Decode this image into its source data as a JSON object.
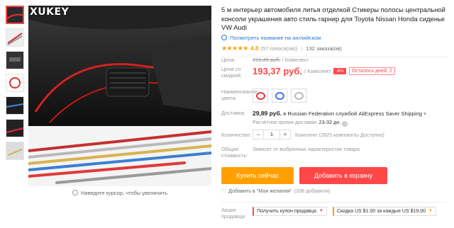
{
  "brand_logo": "XUKEY",
  "zoom_hint": "Наведите курсор, чтобы увеличить",
  "title": "5 м интерьер автомобиля литья отделкой Стикеры полосы центральной консоли украшения авто стиль гарнир для Toyota Nissan Honda сиденье VW Audi",
  "translate_link": "Посмотреть название на английском",
  "rating": {
    "stars": "★★★★★",
    "value": "4.8",
    "reviews": "(57 голоса(ов))",
    "orders": "132 заказа(ов)"
  },
  "price": {
    "label_old": "Цена:",
    "old_value": "210,45 руб.",
    "old_unit": "/ Комплект",
    "label_new": "Цена со скидкой:",
    "new_value": "193,37 руб.",
    "new_unit": "/ Комплект",
    "discount": "-8%",
    "timer": "Осталось дней: 2"
  },
  "colors": {
    "label": "Наименование цвета:",
    "swatch_colors": [
      "#e23b3b",
      "#3b7ae2",
      "#b9b9b9"
    ]
  },
  "shipping": {
    "label": "Доставка:",
    "price": "29,89 руб.",
    "text_in": "в Russian Federation службой AliExpress Saver Shipping",
    "eta_label": "Расчётное время доставки:",
    "eta_value": "23-32 дн.",
    "info_icon": "i"
  },
  "quantity": {
    "label": "Количество:",
    "minus": "−",
    "value": "1",
    "plus": "+",
    "available": "Комплект (2825 комплекты Доступно)"
  },
  "total": {
    "label": "Общая стоимость:",
    "text": "Зависит от выбранных характеристик товара"
  },
  "buttons": {
    "buy_now": "Купить сейчас",
    "add_to_cart": "Добавить в корзину"
  },
  "wishlist": {
    "text": "Добавить в \"Мои желания\"",
    "count": "(208 добавили)"
  },
  "promo": {
    "label": "Акция продавца:",
    "coupon": "Получить купон продавца",
    "discount": "Скидка US $1.00 за каждые US $19.00"
  },
  "accent_colors": {
    "red": "#ff4747",
    "orange": "#ffa000",
    "link": "#2878d0"
  }
}
